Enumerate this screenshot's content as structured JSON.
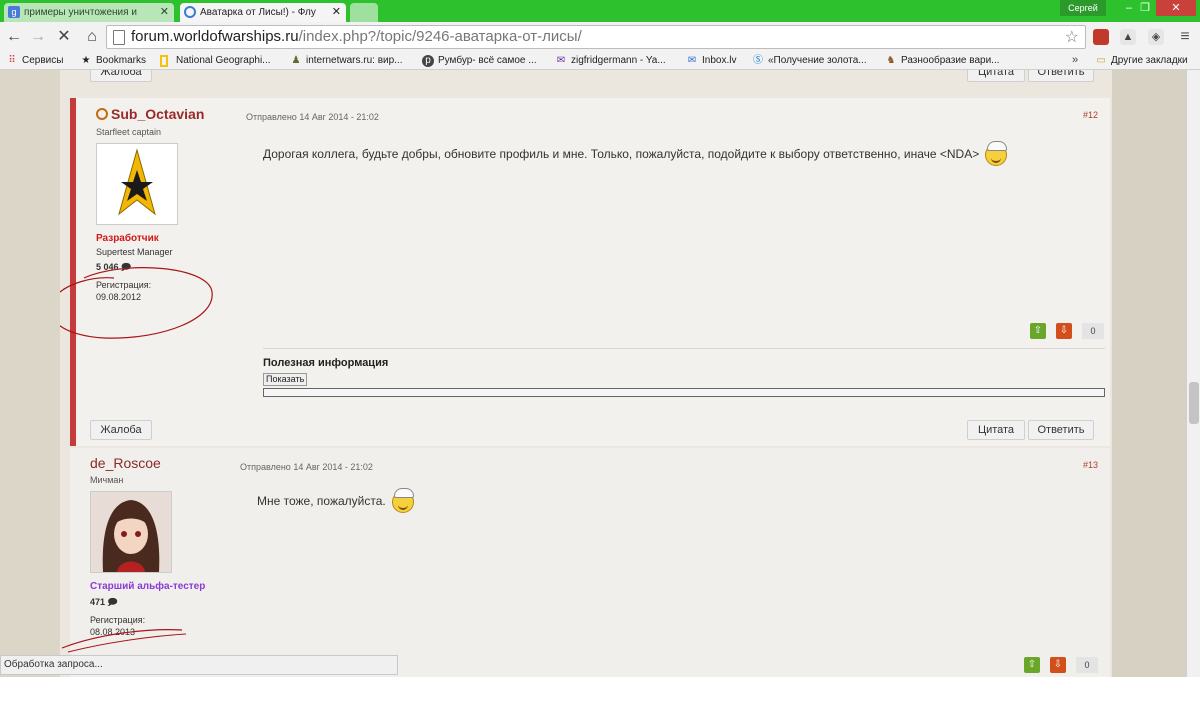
{
  "browser": {
    "tabs": [
      {
        "title": "примеры уничтожения и",
        "favicon": "google-g-icon"
      },
      {
        "title": "Аватарка от Лисы!) - Флу",
        "favicon": "loading-spinner-icon"
      }
    ],
    "profile_name": "Сергей",
    "url_domain": "forum.worldofwarships.ru",
    "url_path": "/index.php?/topic/9246-аватарка-от-лисы/",
    "bookmarks": [
      {
        "label": "Сервисы",
        "icon": "apps-grid-icon"
      },
      {
        "label": "Bookmarks",
        "icon": "star-icon"
      },
      {
        "label": "National Geographi...",
        "icon": "natgeo-icon"
      },
      {
        "label": "internetwars.ru: вир...",
        "icon": "soldier-icon"
      },
      {
        "label": "Румбур- всё самое ...",
        "icon": "pinterest-icon"
      },
      {
        "label": "zigfridgermann - Ya...",
        "icon": "mail-envelope-icon"
      },
      {
        "label": "Inbox.lv",
        "icon": "inbox-icon"
      },
      {
        "label": "«Получение золота...",
        "icon": "skype-icon"
      },
      {
        "label": "Разнообразие вари...",
        "icon": "game-icon"
      }
    ],
    "bookmarks_more": "»",
    "other_bookmarks": "Другие закладки",
    "status": "Обработка запроса..."
  },
  "prev_post": {
    "report_label": "Жалоба",
    "quote_label": "Цитата",
    "reply_label": "Ответить"
  },
  "post12": {
    "author": "Sub_Octavian",
    "rank": "Starfleet captain",
    "group": "Разработчик",
    "group_color": "#d11919",
    "title": "Supertest Manager",
    "posts_count": "5 046",
    "reg_label": "Регистрация:",
    "reg_date": "09.08.2012",
    "sent": "Отправлено 14 Авг 2014 - 21:02",
    "number": "#12",
    "text": "Дорогая коллега, будьте добры,  обновите профиль и мне. Только, пожалуйста, подойдите к выбору ответственно, иначе <NDA>",
    "reputation": "0",
    "useful_title": "Полезная информация",
    "show_label": "Показать",
    "report_label": "Жалоба",
    "quote_label": "Цитата",
    "reply_label": "Ответить"
  },
  "post13": {
    "author": "de_Roscoe",
    "rank": "Мичман",
    "group": "Старший альфа-тестер",
    "group_color": "#8a3ad6",
    "posts_count": "471",
    "reg_label": "Регистрация:",
    "reg_date": "08.08.2013",
    "sent": "Отправлено 14 Авг 2014 - 21:02",
    "number": "#13",
    "text": "Мне тоже, пожалуйста.",
    "reputation": "0"
  }
}
